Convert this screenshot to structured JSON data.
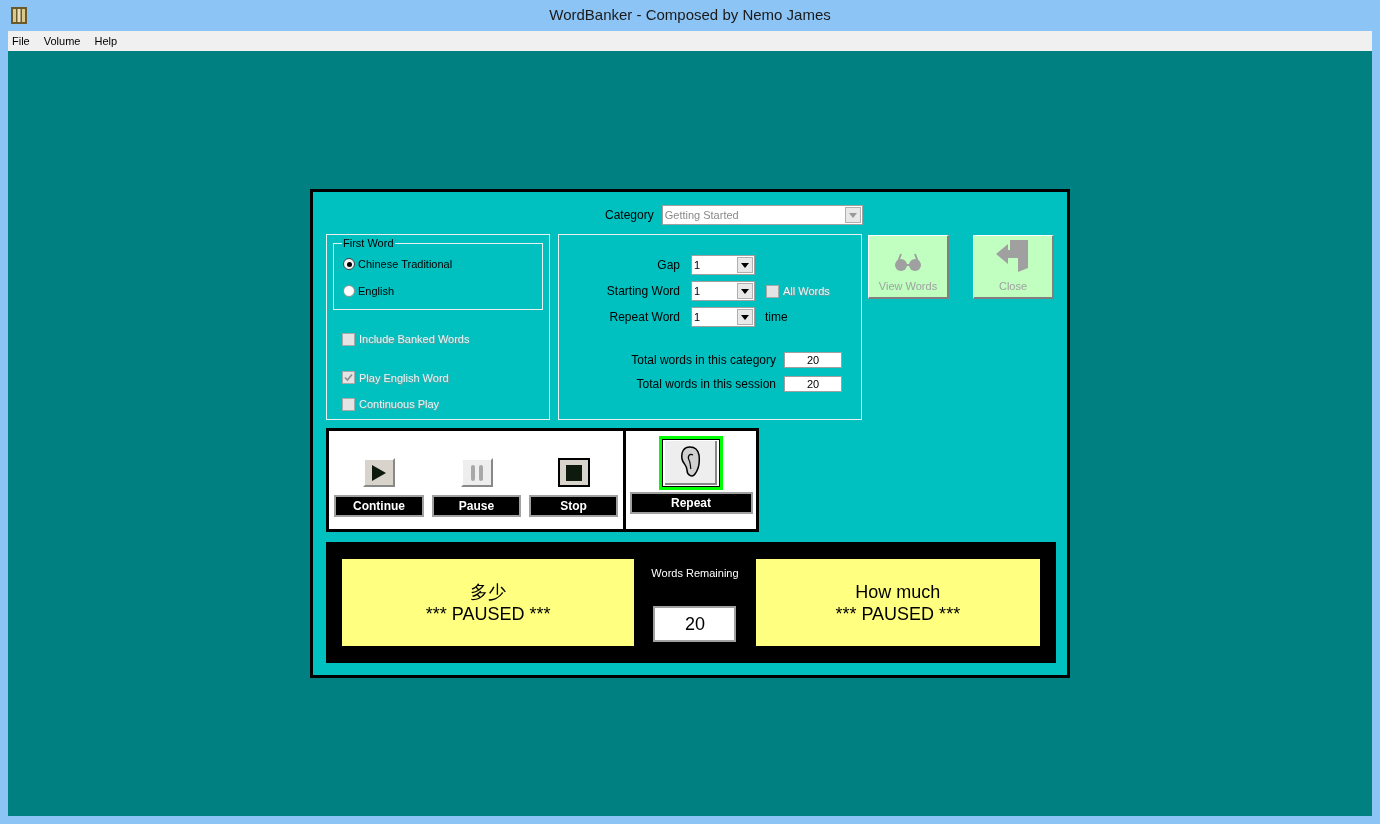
{
  "window": {
    "title": "WordBanker - Composed by Nemo James"
  },
  "menu": [
    "File",
    "Volume",
    "Help"
  ],
  "category": {
    "label": "Category",
    "value": "Getting Started",
    "disabled": true
  },
  "first_word": {
    "legend": "First Word",
    "options": [
      {
        "label": "Chinese Traditional",
        "selected": true
      },
      {
        "label": "English",
        "selected": false
      }
    ]
  },
  "options": [
    {
      "label": "Include Banked Words",
      "checked": false,
      "disabled": true
    },
    {
      "label": "Play English Word",
      "checked": true,
      "disabled": true
    },
    {
      "label": "Continuous Play",
      "checked": false,
      "disabled": true
    }
  ],
  "settings": [
    {
      "label": "Gap",
      "value": "1"
    },
    {
      "label": "Starting Word",
      "value": "1",
      "checkbox": {
        "label": "All Words",
        "checked": false,
        "disabled": true
      }
    },
    {
      "label": "Repeat Word",
      "value": "1",
      "suffix": "time"
    }
  ],
  "totals": [
    {
      "label": "Total words in this category",
      "value": "20"
    },
    {
      "label": "Total words in this session",
      "value": "20"
    }
  ],
  "side_buttons": [
    {
      "label": "View Words",
      "kind": "glasses",
      "disabled": true
    },
    {
      "label": "Close",
      "kind": "exit",
      "disabled": true
    }
  ],
  "transport": [
    {
      "label": "Continue",
      "kind": "play",
      "disabled": false
    },
    {
      "label": "Pause",
      "kind": "pause",
      "disabled": true
    },
    {
      "label": "Stop",
      "kind": "stop",
      "disabled": false
    }
  ],
  "repeat": {
    "label": "Repeat",
    "highlighted": true
  },
  "display": {
    "first": [
      "多少",
      "*** PAUSED ***"
    ],
    "remaining": {
      "label": "Words Remaining",
      "value": "20"
    },
    "second": [
      "How much",
      "*** PAUSED ***"
    ]
  }
}
